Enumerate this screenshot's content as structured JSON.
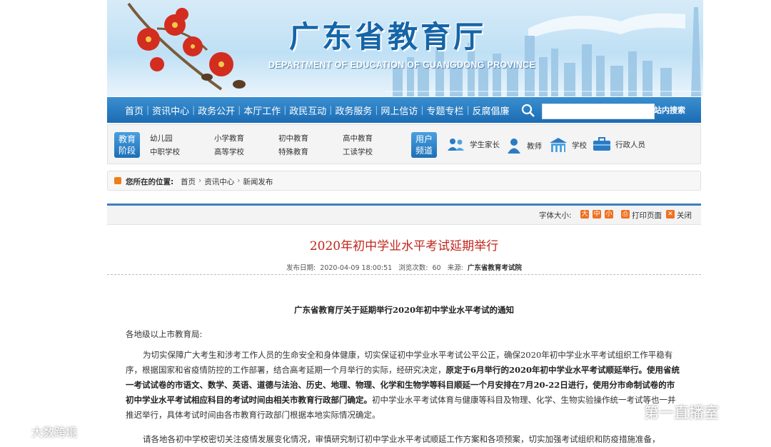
{
  "banner": {
    "title": "广东省教育厅",
    "subtitle": "DEPARTMENT OF EDUCATION OF GUANGDONG PROVINCE"
  },
  "nav": {
    "items": [
      "首页",
      "资讯中心",
      "政务公开",
      "本厅工作",
      "政民互动",
      "政务服务",
      "网上信访",
      "专题专栏",
      "反腐倡廉"
    ],
    "search_button": "站内搜索",
    "search_value": ""
  },
  "categories": {
    "stage_badge": [
      "教育",
      "阶段"
    ],
    "stage_links": [
      "幼儿园",
      "小学教育",
      "初中教育",
      "高中教育",
      "中职学校",
      "高等学校",
      "特殊教育",
      "工读学校"
    ],
    "user_badge": [
      "用户",
      "频道"
    ],
    "roles": [
      {
        "label": "学生家长",
        "icon": "parents-icon"
      },
      {
        "label": "教师",
        "icon": "teacher-icon"
      },
      {
        "label": "学校",
        "icon": "school-icon"
      },
      {
        "label": "行政人员",
        "icon": "briefcase-icon"
      }
    ]
  },
  "breadcrumb": {
    "label": "您所在的位置:",
    "items": [
      "首页",
      "资讯中心",
      "新闻发布"
    ],
    "separator": "›"
  },
  "toolbar": {
    "font_size_label": "字体大小:",
    "sizes": [
      "大",
      "中",
      "小"
    ],
    "print_label": "打印页面",
    "close_label": "关闭"
  },
  "article": {
    "title": "2020年初中学业水平考试延期举行",
    "meta_date_label": "发布日期:",
    "meta_date": "2020-04-09 18:00:51",
    "meta_views_label": "浏览次数:",
    "meta_views": "60",
    "meta_source_label": "来源:",
    "meta_source": "广东省教育考试院",
    "notice_title": "广东省教育厅关于延期举行2020年初中学业水平考试的通知",
    "greeting": "各地级以上市教育局:",
    "p1_a": "为切实保障广大考生和涉考工作人员的生命安全和身体健康，切实保证初中学业水平考试公平公正，确保2020年初中学业水平考试组织工作平稳有序，根据国家和省疫情防控的工作部署，结合高考延期一个月举行的实际，经研究决定，",
    "p1_b": "原定于6月举行的2020年初中学业水平考试顺延举行。使用省统一考试试卷的市语文、数学、英语、道德与法治、历史、地理、物理、化学和生物学等科目顺延一个月安排在7月20-22日进行，使用分市命制试卷的市初中学业水平考试相应科目的考试时间由相关市教育行政部门确定。",
    "p1_c": "初中学业水平考试体育与健康等科目及物理、化学、生物实验操作统一考试等也一并推迟举行，具体考试时间由各市教育行政部门根据本地实际情况确定。",
    "p2": "请各地各初中学校密切关注疫情发展变化情况，审慎研究制订初中学业水平考试顺延工作方案和各项预案，切实加强考试组织和防疫措施准备，"
  },
  "watermarks": {
    "left": "大数跨境",
    "right": "第一直播室"
  },
  "colors": {
    "nav_blue": "#1c6cb3",
    "title_red": "#c0251b",
    "accent_orange": "#f07020"
  }
}
